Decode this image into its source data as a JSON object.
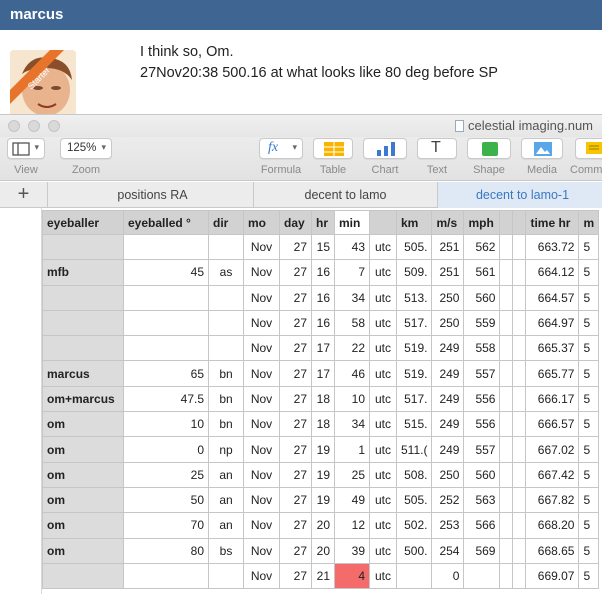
{
  "forum": {
    "username": "marcus",
    "post_line1": "I think so, Om.",
    "post_line2": "27Nov20:38 500.16 at what looks like 80 deg before SP",
    "avatar_badge": "Starter"
  },
  "window": {
    "title": "celestial imaging.num",
    "toolbar": {
      "view_label": "View",
      "zoom_value": "125%",
      "zoom_label": "Zoom",
      "formula_label": "Formula",
      "table_label": "Table",
      "chart_label": "Chart",
      "text_label": "Text",
      "shape_label": "Shape",
      "media_label": "Media",
      "comment_label": "Comm",
      "text_glyph": "T",
      "formula_glyph": "fx"
    },
    "add_sheet": "+",
    "tabs": [
      "positions RA",
      "decent to lamo",
      "decent to lamo-1"
    ],
    "active_tab_index": 2
  },
  "table": {
    "headers": [
      "eyeballer",
      "eyeballed °",
      "dir",
      "mo",
      "day",
      "hr",
      "min",
      "",
      "km",
      "m/s",
      "mph",
      "",
      "",
      "time hr",
      "m"
    ],
    "rows": [
      [
        "",
        "",
        "",
        "Nov",
        "27",
        "15",
        "43",
        "utc",
        "505.",
        "251",
        "562",
        "",
        "",
        "663.72",
        "5"
      ],
      [
        "mfb",
        "45",
        "as",
        "Nov",
        "27",
        "16",
        "7",
        "utc",
        "509.",
        "251",
        "561",
        "",
        "",
        "664.12",
        "5"
      ],
      [
        "",
        "",
        "",
        "Nov",
        "27",
        "16",
        "34",
        "utc",
        "513.",
        "250",
        "560",
        "",
        "",
        "664.57",
        "5"
      ],
      [
        "",
        "",
        "",
        "Nov",
        "27",
        "16",
        "58",
        "utc",
        "517.",
        "250",
        "559",
        "",
        "",
        "664.97",
        "5"
      ],
      [
        "",
        "",
        "",
        "Nov",
        "27",
        "17",
        "22",
        "utc",
        "519.",
        "249",
        "558",
        "",
        "",
        "665.37",
        "5"
      ],
      [
        "marcus",
        "65",
        "bn",
        "Nov",
        "27",
        "17",
        "46",
        "utc",
        "519.",
        "249",
        "557",
        "",
        "",
        "665.77",
        "5"
      ],
      [
        "om+marcus",
        "47.5",
        "bn",
        "Nov",
        "27",
        "18",
        "10",
        "utc",
        "517.",
        "249",
        "556",
        "",
        "",
        "666.17",
        "5"
      ],
      [
        "om",
        "10",
        "bn",
        "Nov",
        "27",
        "18",
        "34",
        "utc",
        "515.",
        "249",
        "556",
        "",
        "",
        "666.57",
        "5"
      ],
      [
        "om",
        "0",
        "np",
        "Nov",
        "27",
        "19",
        "1",
        "utc",
        "511.(",
        "249",
        "557",
        "",
        "",
        "667.02",
        "5"
      ],
      [
        "om",
        "25",
        "an",
        "Nov",
        "27",
        "19",
        "25",
        "utc",
        "508.",
        "250",
        "560",
        "",
        "",
        "667.42",
        "5"
      ],
      [
        "om",
        "50",
        "an",
        "Nov",
        "27",
        "19",
        "49",
        "utc",
        "505.",
        "252",
        "563",
        "",
        "",
        "667.82",
        "5"
      ],
      [
        "om",
        "70",
        "an",
        "Nov",
        "27",
        "20",
        "12",
        "utc",
        "502.",
        "253",
        "566",
        "",
        "",
        "668.20",
        "5"
      ],
      [
        "om",
        "80",
        "bs",
        "Nov",
        "27",
        "20",
        "39",
        "utc",
        "500.",
        "254",
        "569",
        "",
        "",
        "668.65",
        "5"
      ],
      [
        "",
        "",
        "",
        "Nov",
        "27",
        "21",
        "4",
        "utc",
        "",
        "0",
        "",
        "",
        "",
        "669.07",
        "5"
      ]
    ],
    "highlight": {
      "row": 13,
      "col": 6,
      "color": "#f36b6b"
    },
    "selected_header_col": 6
  }
}
